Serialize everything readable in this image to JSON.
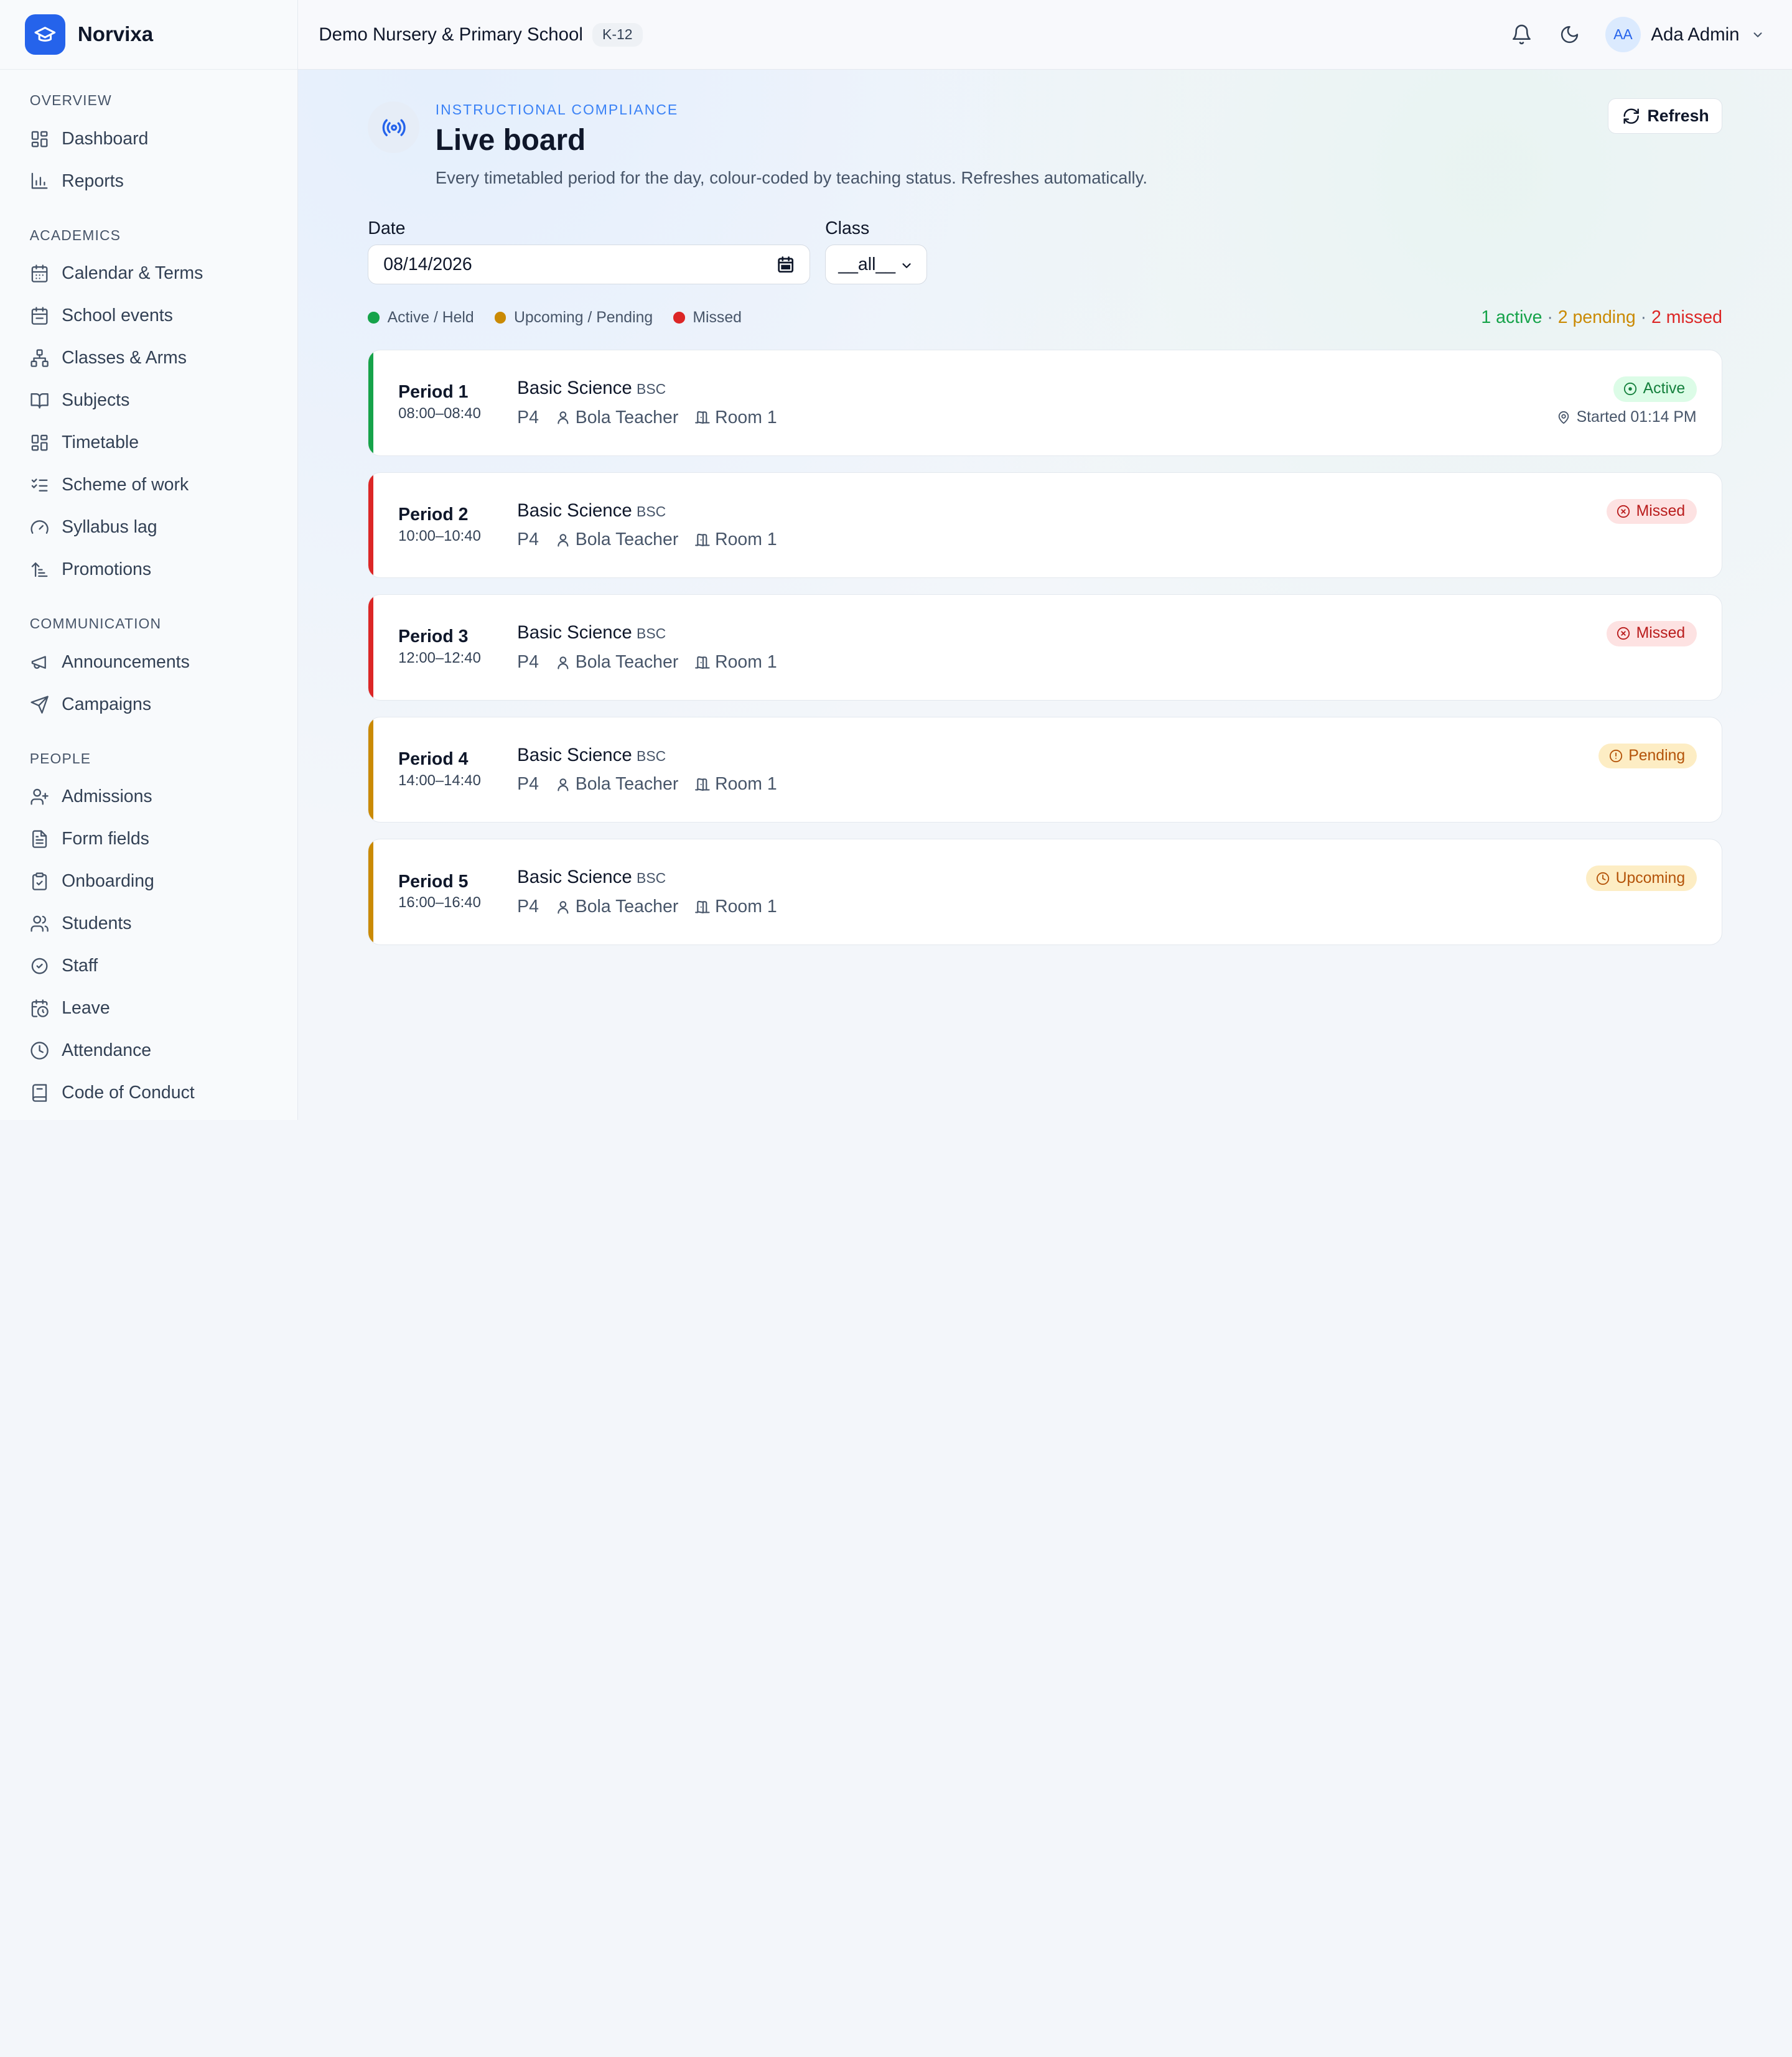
{
  "brand": {
    "name": "Norvixa"
  },
  "header": {
    "school_name": "Demo Nursery & Primary School",
    "school_level": "K-12",
    "user_initials": "AA",
    "user_name": "Ada Admin"
  },
  "sidebar": {
    "sections": [
      {
        "heading": "Overview",
        "items": [
          {
            "label": "Dashboard",
            "icon": "grid-icon"
          },
          {
            "label": "Reports",
            "icon": "bar-chart-icon"
          }
        ]
      },
      {
        "heading": "Academics",
        "items": [
          {
            "label": "Calendar & Terms",
            "icon": "calendar-icon"
          },
          {
            "label": "School events",
            "icon": "calendar-days-icon"
          },
          {
            "label": "Classes & Arms",
            "icon": "network-icon"
          },
          {
            "label": "Subjects",
            "icon": "book-open-icon"
          },
          {
            "label": "Timetable",
            "icon": "grid-icon"
          },
          {
            "label": "Scheme of work",
            "icon": "list-checks-icon"
          },
          {
            "label": "Syllabus lag",
            "icon": "gauge-icon"
          },
          {
            "label": "Promotions",
            "icon": "sort-ascending-icon"
          }
        ]
      },
      {
        "heading": "Communication",
        "items": [
          {
            "label": "Announcements",
            "icon": "megaphone-icon"
          },
          {
            "label": "Campaigns",
            "icon": "send-icon"
          }
        ]
      },
      {
        "heading": "People",
        "items": [
          {
            "label": "Admissions",
            "icon": "user-plus-icon"
          },
          {
            "label": "Form fields",
            "icon": "file-text-icon"
          },
          {
            "label": "Onboarding",
            "icon": "clipboard-check-icon"
          },
          {
            "label": "Students",
            "icon": "users-icon"
          },
          {
            "label": "Staff",
            "icon": "badge-check-icon"
          },
          {
            "label": "Leave",
            "icon": "calendar-clock-icon"
          },
          {
            "label": "Attendance",
            "icon": "clock-icon"
          },
          {
            "label": "Code of Conduct",
            "icon": "book-icon"
          }
        ]
      }
    ]
  },
  "page": {
    "kicker": "INSTRUCTIONAL COMPLIANCE",
    "title": "Live board",
    "subtitle": "Every timetabled period for the day, colour-coded by teaching status. Refreshes automatically.",
    "refresh_label": "Refresh"
  },
  "filters": {
    "date_label": "Date",
    "date_value": "08/14/2026",
    "class_label": "Class",
    "class_value": "__all__"
  },
  "legend": [
    {
      "label": "Active / Held",
      "color": "#16a34a"
    },
    {
      "label": "Upcoming / Pending",
      "color": "#ca8a04"
    },
    {
      "label": "Missed",
      "color": "#dc2626"
    }
  ],
  "summary": {
    "active": "1 active",
    "pending": "2 pending",
    "missed": "2 missed",
    "separator": " · "
  },
  "periods": [
    {
      "name": "Period 1",
      "time": "08:00–08:40",
      "subject": "Basic Science",
      "code": "BSC",
      "class": "P4",
      "teacher": "Bola Teacher",
      "room": "Room 1",
      "status": "Active",
      "status_type": "active",
      "started": "Started 01:14 PM",
      "bar_color": "#16a34a"
    },
    {
      "name": "Period 2",
      "time": "10:00–10:40",
      "subject": "Basic Science",
      "code": "BSC",
      "class": "P4",
      "teacher": "Bola Teacher",
      "room": "Room 1",
      "status": "Missed",
      "status_type": "missed",
      "started": "",
      "bar_color": "#dc2626"
    },
    {
      "name": "Period 3",
      "time": "12:00–12:40",
      "subject": "Basic Science",
      "code": "BSC",
      "class": "P4",
      "teacher": "Bola Teacher",
      "room": "Room 1",
      "status": "Missed",
      "status_type": "missed",
      "started": "",
      "bar_color": "#dc2626"
    },
    {
      "name": "Period 4",
      "time": "14:00–14:40",
      "subject": "Basic Science",
      "code": "BSC",
      "class": "P4",
      "teacher": "Bola Teacher",
      "room": "Room 1",
      "status": "Pending",
      "status_type": "pending",
      "started": "",
      "bar_color": "#ca8a04"
    },
    {
      "name": "Period 5",
      "time": "16:00–16:40",
      "subject": "Basic Science",
      "code": "BSC",
      "class": "P4",
      "teacher": "Bola Teacher",
      "room": "Room 1",
      "status": "Upcoming",
      "status_type": "pending",
      "started": "",
      "bar_color": "#ca8a04"
    }
  ]
}
